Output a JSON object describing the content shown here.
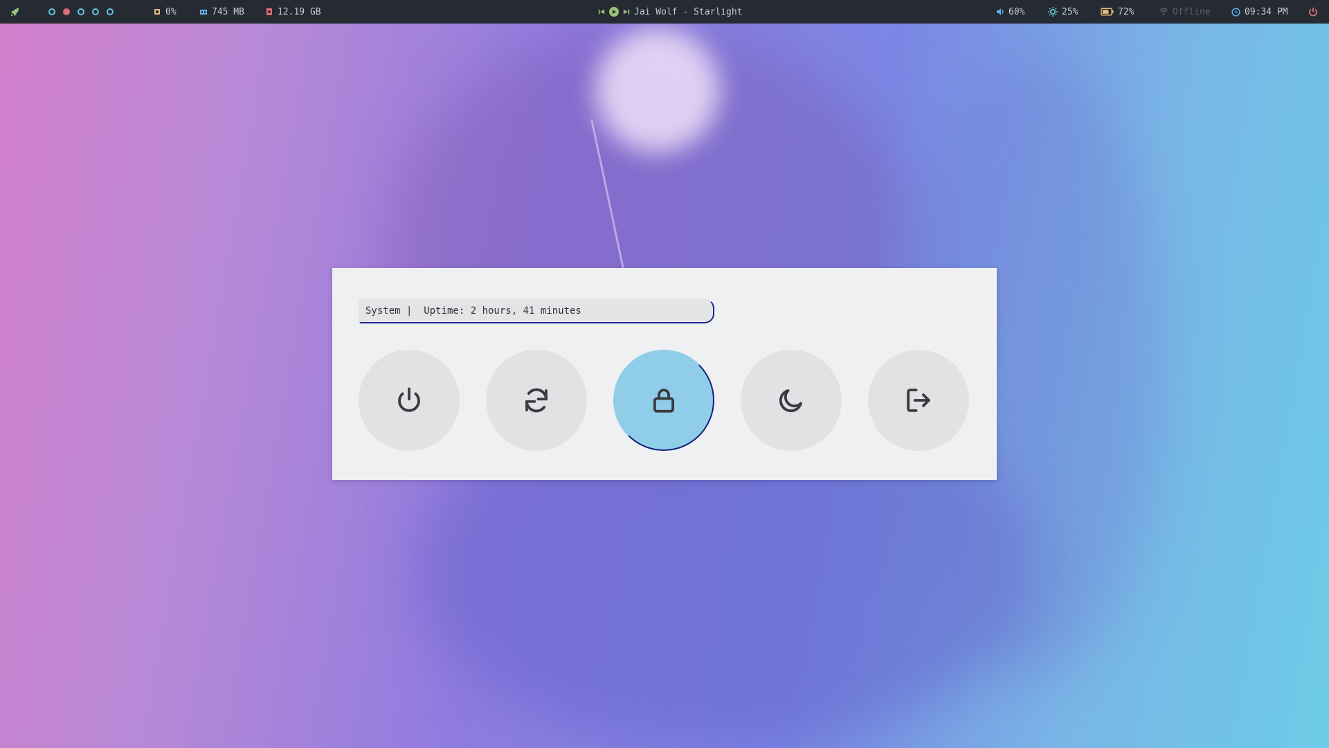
{
  "top_bar": {
    "workspaces": [
      {
        "name": "workspace-1",
        "active": false
      },
      {
        "name": "workspace-2",
        "active": true
      },
      {
        "name": "workspace-3",
        "active": false
      },
      {
        "name": "workspace-4",
        "active": false
      },
      {
        "name": "workspace-5",
        "active": false
      }
    ],
    "cpu": "0%",
    "memory": "745 MB",
    "disk": "12.19 GB",
    "now_playing": "Jai Wolf - Starlight",
    "volume": "60%",
    "brightness": "25%",
    "battery": "72%",
    "network": "Offline",
    "clock": "09:34 PM"
  },
  "power_menu": {
    "prompt_text": "System |  Uptime: 2 hours, 41 minutes",
    "buttons": [
      {
        "name": "shutdown",
        "icon": "power-icon",
        "selected": false
      },
      {
        "name": "reboot",
        "icon": "refresh-icon",
        "selected": false
      },
      {
        "name": "lock",
        "icon": "lock-icon",
        "selected": true
      },
      {
        "name": "suspend",
        "icon": "moon-icon",
        "selected": false
      },
      {
        "name": "logout",
        "icon": "logout-icon",
        "selected": false
      }
    ]
  },
  "colors": {
    "bar_bg": "#262b33",
    "accent_cyan": "#5fc7e0",
    "accent_red": "#e06c75",
    "selected_button": "#8fcde9",
    "selection_border": "#13217a"
  }
}
